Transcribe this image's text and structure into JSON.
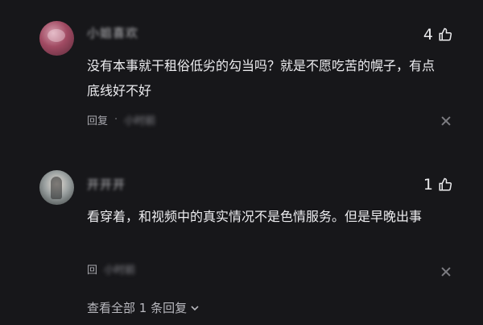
{
  "comments": [
    {
      "username": "小姐喜欢",
      "likes": "4",
      "text": "没有本事就干租俗低劣的勾当吗？就是不愿吃苦的幌子，有点底线好不好",
      "reply_label": "回复",
      "meta_blurred": "小时前"
    },
    {
      "username": "开开开",
      "likes": "1",
      "text": "看穿着，和视频中的真实情况不是色情服务。但是早晚出事",
      "reply_label": "回",
      "meta_blurred": "小时前"
    }
  ],
  "view_all_label": "查看全部 1 条回复",
  "icons": {
    "like": "thumbs-up-icon",
    "close": "close-icon",
    "expand": "chevron-down-icon"
  }
}
